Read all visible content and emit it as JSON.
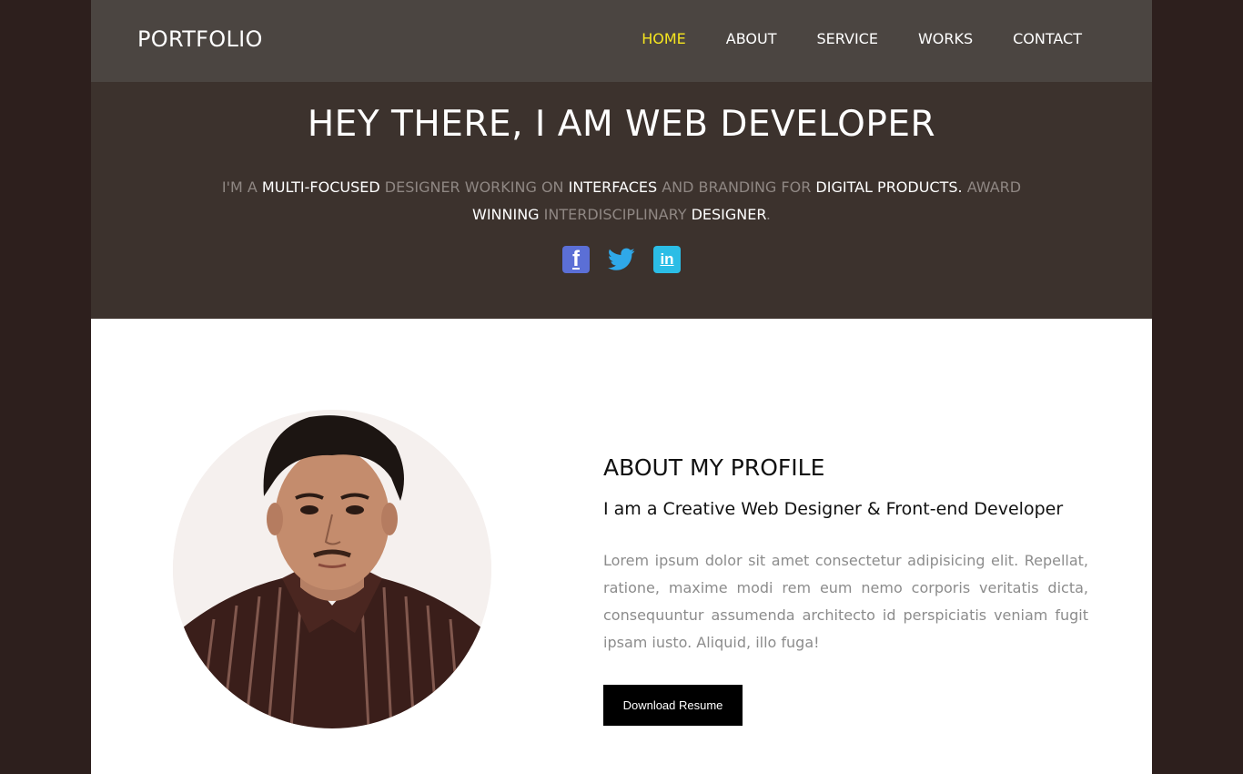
{
  "nav": {
    "brand": "PORTFOLIO",
    "items": [
      {
        "label": "HOME",
        "active": true
      },
      {
        "label": "ABOUT"
      },
      {
        "label": "SERVICE"
      },
      {
        "label": "WORKS"
      },
      {
        "label": "CONTACT"
      }
    ]
  },
  "hero": {
    "title": "HEY THERE, I AM WEB DEVELOPER",
    "subtitle_parts": [
      "I'M A ",
      "MULTI-FOCUSED",
      " DESIGNER WORKING ON ",
      "INTERFACES",
      " AND BRANDING FOR ",
      "DIGITAL PRODUCTS.",
      " AWARD ",
      "WINNING",
      " INTERDISCIPLINARY ",
      "DESIGNER",
      "."
    ],
    "social": [
      {
        "icon": "facebook-icon",
        "glyph": "f"
      },
      {
        "icon": "twitter-icon",
        "glyph": ""
      },
      {
        "icon": "linkedin-icon",
        "glyph": "in"
      }
    ]
  },
  "about": {
    "title": "ABOUT MY PROFILE",
    "subtitle": "I am a Creative Web Designer & Front-end Developer",
    "text": "Lorem ipsum dolor sit amet consectetur adipisicing elit. Repellat, ratione, maxime modi rem eum nemo corporis veritatis dicta, consequuntur assumenda architecto id perspiciatis veniam fugit ipsam iusto. Aliquid, illo fuga!",
    "button": "Download Resume"
  },
  "colors": {
    "outer_bg": "#2d1f1d",
    "navbar_bg": "#4b4541",
    "hero_bg": "#3c322d",
    "accent_active": "#f5e51f"
  }
}
